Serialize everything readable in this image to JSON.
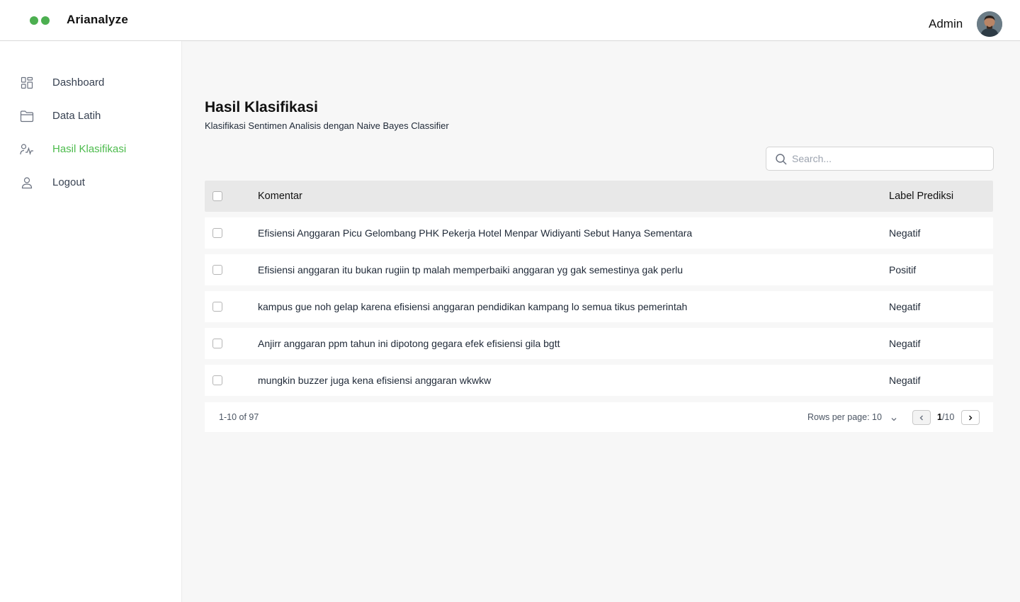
{
  "app": {
    "brand": "Arianalyze",
    "accent_color": "#4cbb4c",
    "logo_color": "#4caf50"
  },
  "header": {
    "user_name": "Admin"
  },
  "sidebar": {
    "items": [
      {
        "label": "Dashboard",
        "icon": "dashboard-icon",
        "active": false
      },
      {
        "label": "Data Latih",
        "icon": "folder-icon",
        "active": false
      },
      {
        "label": "Hasil Klasifikasi",
        "icon": "activity-user-icon",
        "active": true
      },
      {
        "label": "Logout",
        "icon": "user-icon",
        "active": false
      }
    ]
  },
  "main": {
    "title": "Hasil Klasifikasi",
    "subtitle": "Klasifikasi Sentimen Analisis dengan Naive Bayes Classifier",
    "search": {
      "placeholder": "Search...",
      "value": ""
    },
    "table": {
      "columns": [
        "Komentar",
        "Label Prediksi"
      ],
      "rows": [
        {
          "komentar": "Efisiensi Anggaran Picu Gelombang PHK Pekerja Hotel Menpar Widiyanti Sebut Hanya Sementara",
          "label": "Negatif"
        },
        {
          "komentar": "Efisiensi anggaran itu bukan rugiin tp malah memperbaiki anggaran yg gak semestinya gak perlu",
          "label": "Positif"
        },
        {
          "komentar": "kampus gue noh gelap karena efisiensi anggaran pendidikan kampang lo semua tikus pemerintah",
          "label": "Negatif"
        },
        {
          "komentar": "Anjirr anggaran ppm tahun ini dipotong gegara efek efisiensi gila bgtt",
          "label": "Negatif"
        },
        {
          "komentar": "mungkin buzzer juga kena efisiensi anggaran wkwkw",
          "label": "Negatif"
        }
      ]
    },
    "pagination": {
      "range_text": "1-10 of 97",
      "rows_per_page_label": "Rows per page: 10",
      "current_page": "1",
      "total_pages": "/10"
    }
  }
}
